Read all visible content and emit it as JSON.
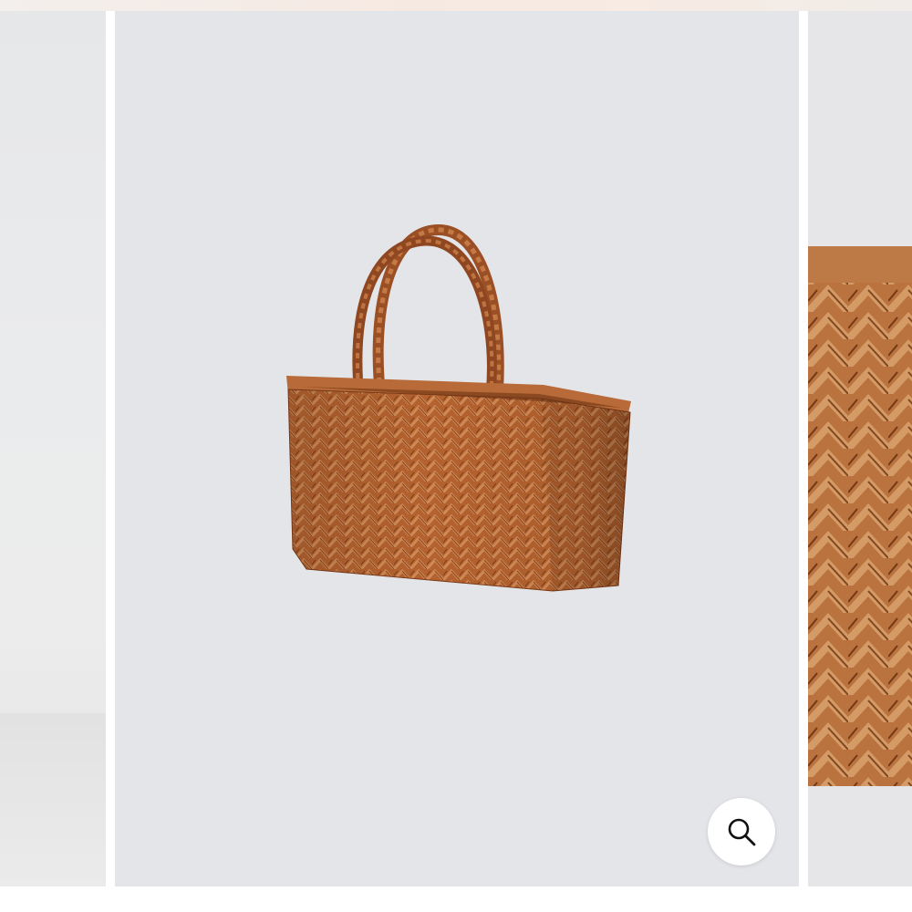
{
  "gallery": {
    "slides": [
      {
        "name": "previous-product-image",
        "icon": "product-photo"
      },
      {
        "name": "tote-bag-product-image",
        "icon": "woven-leather-tote"
      },
      {
        "name": "next-product-image-closeup",
        "icon": "woven-leather-detail"
      }
    ],
    "zoom_button": {
      "icon": "magnifier-icon"
    }
  },
  "colors": {
    "background_main": "#e4e5e9",
    "leather": "#b4622f",
    "leather_dark": "#7a3a17",
    "leather_light": "#d08a55",
    "zoom_button_bg": "#ffffff",
    "zoom_icon": "#111111"
  }
}
